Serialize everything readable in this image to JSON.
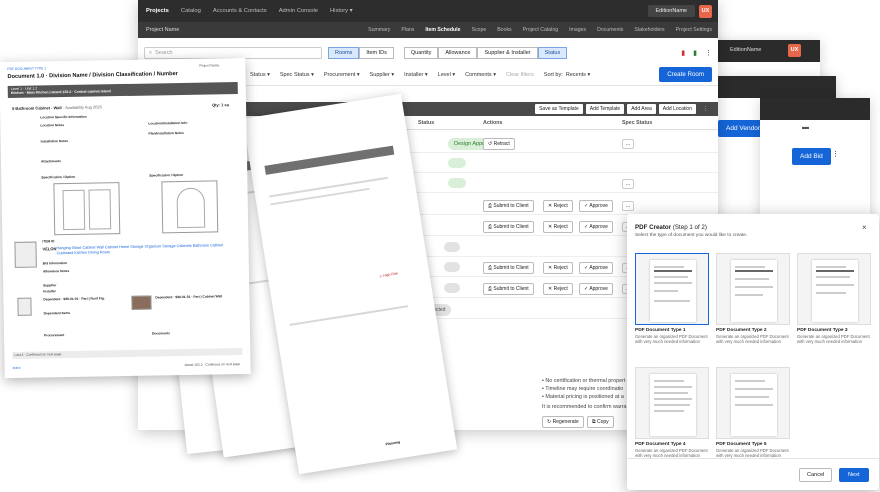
{
  "back_windows": {
    "edition_name": "EditionName",
    "ux_badge": "UX",
    "add_vendor": "Add Vendor",
    "add_bid": "Add Bid"
  },
  "app": {
    "topnav": [
      "Projects",
      "Catalog",
      "Accounts & Contacts",
      "Admin Console",
      "History ▾"
    ],
    "edition_name": "EditionName",
    "user_badge": "UX",
    "project_name": "Project Name",
    "tabs": [
      "Summary",
      "Plans",
      "Item Schedule",
      "Scope",
      "Books",
      "Project Catalog",
      "Images",
      "Documents",
      "Stakeholders",
      "Project Settings"
    ],
    "search_placeholder": "Search",
    "view_toggle": [
      "Rooms",
      "Item IDs"
    ],
    "column_toggle": [
      "Quantity",
      "Allowance",
      "Supplier & Installer",
      "Status"
    ],
    "filters": [
      "Status ▾",
      "Spec Status ▾",
      "Procurement ▾",
      "Supplier ▾",
      "Installer ▾",
      "Level ▾",
      "Comments ▾"
    ],
    "clear_filters": "Clear filters",
    "sort_label": "Sort by:",
    "sort_value": "Recents ▾",
    "create_room": "Create Room",
    "table_actions": [
      "Save as Template",
      "Add Template",
      "Add Area",
      "Add Location"
    ],
    "columns": [
      "Status",
      "Actions",
      "Spec Status"
    ],
    "status_approved": "Design Approved",
    "retract": "Retract",
    "submit": "Submit to Client",
    "reject": "Reject",
    "approve": "Approve",
    "selected": "Selected",
    "ai_notes": [
      "• No certification or thermal propert",
      "• Timeline may require coordinatio",
      "• Material pricing is positioned at a",
      "It is recommended to confirm warra"
    ],
    "regenerate": "Regenerate",
    "copy": "Copy",
    "more": "..."
  },
  "doc": {
    "header_left": "PDF DOCUMENT TYPE 1",
    "header_right": "Project Name",
    "title": "Document 1.0 · Division Name / Division Classification / Number",
    "band_line1": "Level 1 · Unit 1.2",
    "band_line2": "Kitchen · Main Kitchen | Island 102.2 · Central cabinet island",
    "item_header": "5 Bathroom Cabinet - Wall",
    "item_avail": "· Availability Aug 2025",
    "qty": "Qty: 1 ea",
    "location_heading": "Location Specific Information",
    "location_notes": "Location Notes",
    "installation_notes": "Installation Notes",
    "locinstall_info": "Location/Installation Info",
    "plan_install": "Plan/Installation Notes",
    "attachments": "Attachments",
    "spec_image": "Specification / Option",
    "spec_image_2": "Specification / Option",
    "item_id": "ITEM ID",
    "vendor": "VELON",
    "product": "Hanging Glass Cabinet Wall Cabinet Home Storage Organizer Storage Cabinets Bathroom Cabinet Cupboard Kitchen Dining Room",
    "bid_info": "Bid Information",
    "allowance": "Allowance Notes",
    "supplier": "Supplier",
    "installer": "Installer",
    "dependent_a": "Dependent · 999-01-01 · Part | Roof Fig.",
    "dependent_b": "Dependent · 999-01-01 · Part | Cabinet Wall",
    "dependent_items": "Dependent Items",
    "procurement": "Procurement",
    "documents": "Documents",
    "footer_left": "Last 3 · Confirmed on next page",
    "footer_right": "Island 102.2 · Continues on next page",
    "footer_page": "Index"
  },
  "papers": {
    "high_risk": "⚠ High Risk",
    "planning": "Planning",
    "continued": "Continued on next page"
  },
  "modal": {
    "title": "PDF Creator",
    "step": "(Step 1 of 2)",
    "subtitle": "Select the type of document you would like to create.",
    "close": "×",
    "cards": [
      {
        "title": "PDF Document Type 1",
        "desc": "Generate an organized PDF Document with very much needed information"
      },
      {
        "title": "PDF Document Type 2",
        "desc": "Generate an organized PDF Document with very much needed information"
      },
      {
        "title": "PDF Document Type 3",
        "desc": "Generate an organized PDF Document with very much needed information"
      },
      {
        "title": "PDF Document Type 4",
        "desc": "Generate an organized PDF Document with very much needed information"
      },
      {
        "title": "PDF Document Type 5",
        "desc": "Generate an organized PDF Document with very much needed information"
      }
    ],
    "cancel": "Cancel",
    "next": "Next"
  },
  "colors": {
    "primary": "#1565d8",
    "dark_nav": "#2d2d2d",
    "approved_bg": "#d9efd7",
    "badge": "#e8674a"
  }
}
